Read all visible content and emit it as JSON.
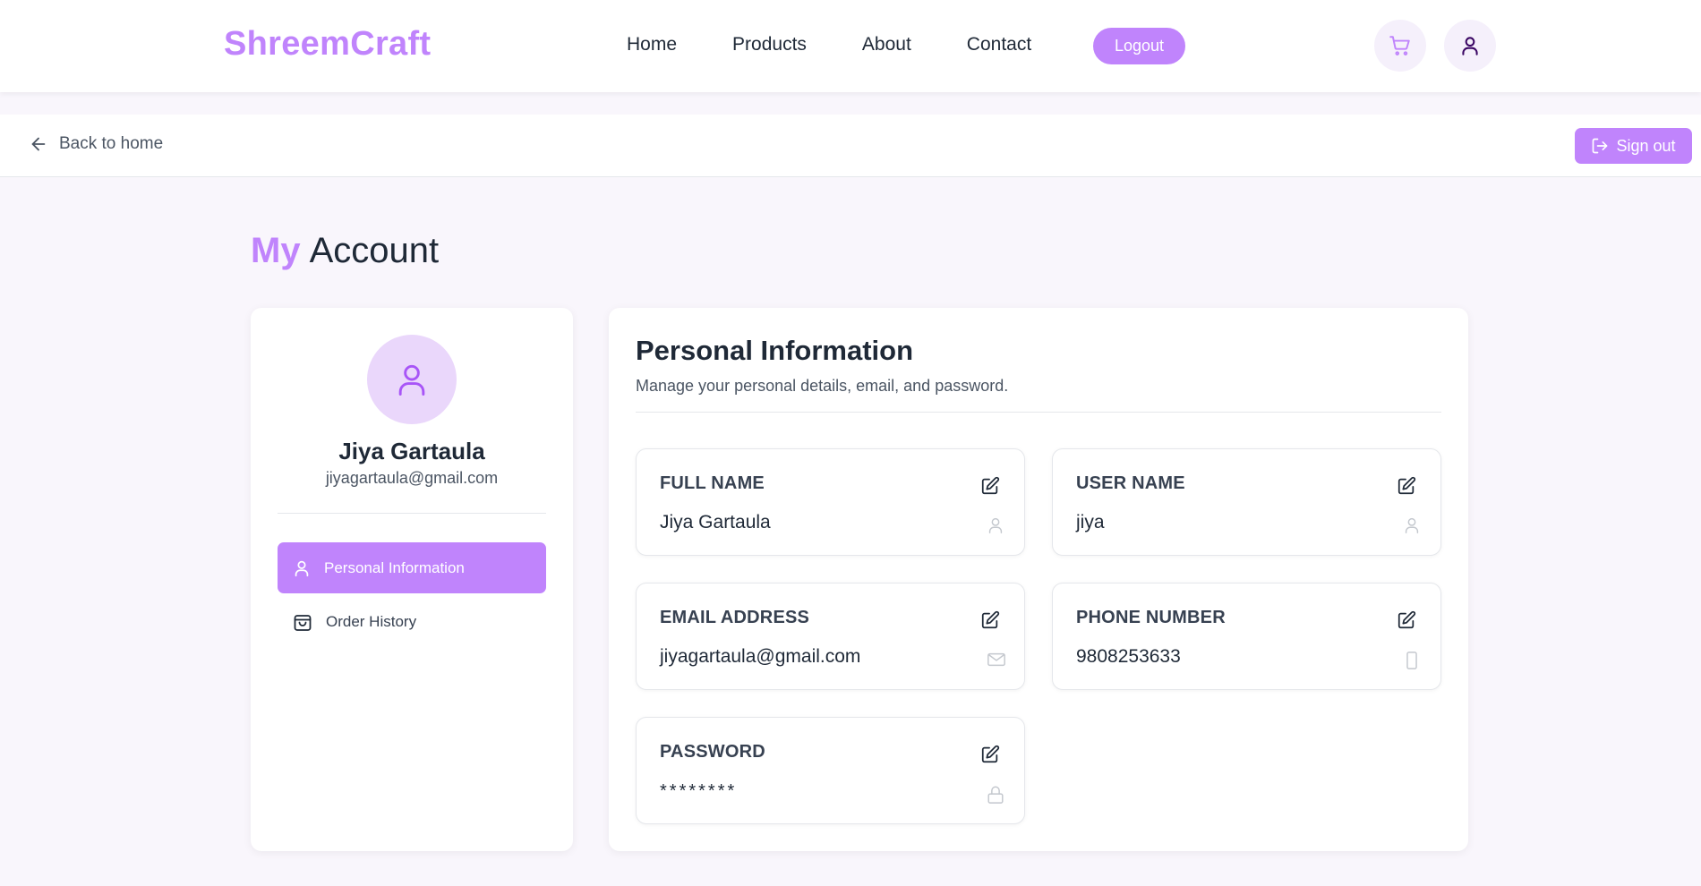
{
  "navbar": {
    "brand": "ShreemCraft",
    "links": [
      "Home",
      "Products",
      "About",
      "Contact"
    ],
    "logout_label": "Logout",
    "icons": [
      "cart-icon",
      "user-icon"
    ]
  },
  "subbar": {
    "back_label": "Back to home",
    "signout_label": "Sign out"
  },
  "page": {
    "title_accent": "My",
    "title_rest": "Account"
  },
  "profile": {
    "name": "Jiya Gartaula",
    "email": "jiyagartaula@gmail.com",
    "menu": [
      {
        "label": "Personal Information",
        "icon": "user-icon",
        "active": true
      },
      {
        "label": "Order History",
        "icon": "shopping-bag-icon",
        "active": false
      }
    ]
  },
  "personal_info": {
    "title": "Personal Information",
    "subtitle": "Manage your personal details, email, and password.",
    "fields": [
      {
        "label": "FULL NAME",
        "value": "Jiya Gartaula",
        "icon": "user-icon"
      },
      {
        "label": "USER NAME",
        "value": "jiya",
        "icon": "user-icon"
      },
      {
        "label": "EMAIL ADDRESS",
        "value": "jiyagartaula@gmail.com",
        "icon": "mail-icon"
      },
      {
        "label": "PHONE NUMBER",
        "value": "9808253633",
        "icon": "phone-icon"
      },
      {
        "label": "PASSWORD",
        "value": "********",
        "icon": "lock-icon"
      }
    ]
  },
  "colors": {
    "accent": "#c084fc",
    "accent_light": "#ead7fb",
    "background": "#f9f6fc"
  }
}
